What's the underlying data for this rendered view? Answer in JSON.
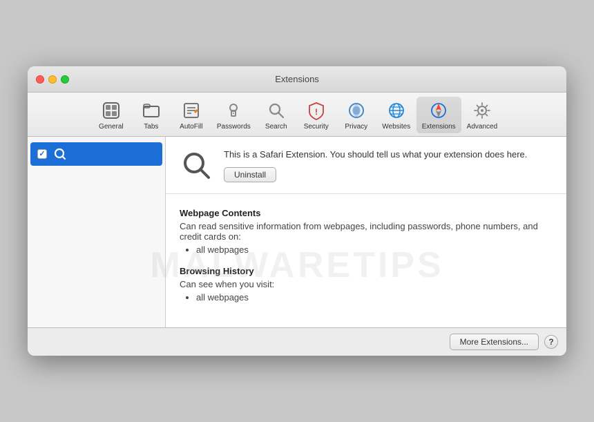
{
  "window": {
    "title": "Extensions"
  },
  "toolbar": {
    "items": [
      {
        "id": "general",
        "label": "General",
        "icon": "general-icon"
      },
      {
        "id": "tabs",
        "label": "Tabs",
        "icon": "tabs-icon"
      },
      {
        "id": "autofill",
        "label": "AutoFill",
        "icon": "autofill-icon"
      },
      {
        "id": "passwords",
        "label": "Passwords",
        "icon": "passwords-icon"
      },
      {
        "id": "search",
        "label": "Search",
        "icon": "search-icon"
      },
      {
        "id": "security",
        "label": "Security",
        "icon": "security-icon"
      },
      {
        "id": "privacy",
        "label": "Privacy",
        "icon": "privacy-icon"
      },
      {
        "id": "websites",
        "label": "Websites",
        "icon": "websites-icon"
      },
      {
        "id": "extensions",
        "label": "Extensions",
        "icon": "extensions-icon",
        "active": true
      },
      {
        "id": "advanced",
        "label": "Advanced",
        "icon": "advanced-icon"
      }
    ]
  },
  "sidebar": {
    "items": [
      {
        "id": "search-ext",
        "label": "",
        "enabled": true
      }
    ]
  },
  "detail": {
    "description": "This is a Safari Extension. You should tell us what your extension does here.",
    "uninstall_label": "Uninstall",
    "permissions": [
      {
        "title": "Webpage Contents",
        "description": "Can read sensitive information from webpages, including passwords, phone numbers, and credit cards on:",
        "items": [
          "all webpages"
        ]
      },
      {
        "title": "Browsing History",
        "description": "Can see when you visit:",
        "items": [
          "all webpages"
        ]
      }
    ]
  },
  "bottom_bar": {
    "more_extensions_label": "More Extensions...",
    "help_label": "?"
  },
  "watermark": {
    "text": "MALWARETIPS"
  }
}
